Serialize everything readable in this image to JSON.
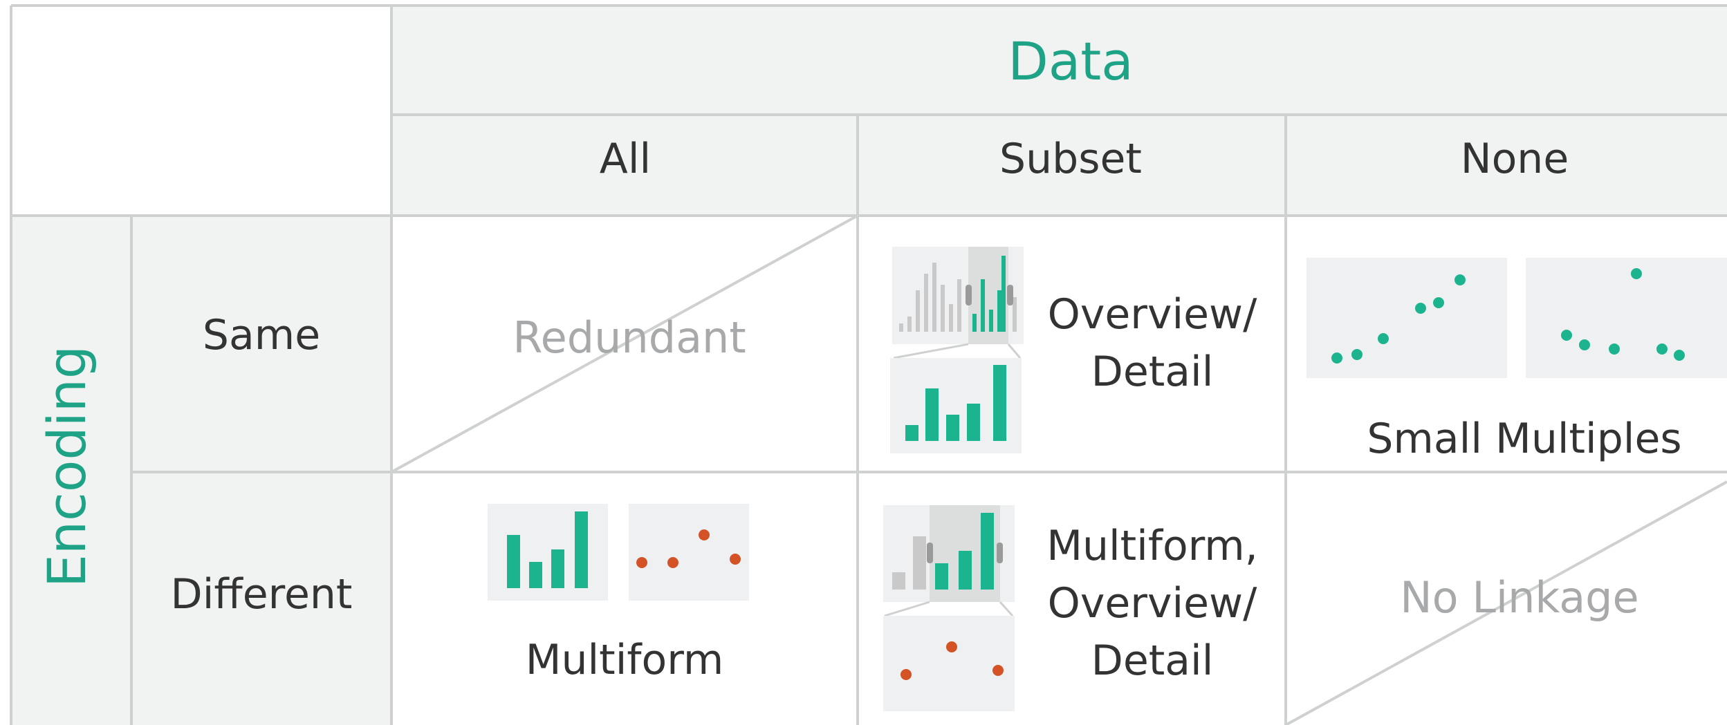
{
  "title": "Data",
  "row_axis_label": "Encoding",
  "columns": [
    "All",
    "Subset",
    "None"
  ],
  "rows": [
    "Same",
    "Different"
  ],
  "cells": {
    "same_all": "Redundant",
    "same_subset": [
      "Overview/",
      "Detail"
    ],
    "same_none": "Small Multiples",
    "different_all": "Multiform",
    "different_subset": [
      "Multiform,",
      "Overview/",
      "Detail"
    ],
    "different_none": "No Linkage"
  },
  "colors": {
    "accent": "#1fa387",
    "teal_mark": "#1cb38f",
    "orange_mark": "#d45326",
    "header_bg": "#f1f2f2",
    "grid_line": "#cfd0d0",
    "muted_text": "#a7a9ab",
    "body_text": "#333333",
    "thumb_bg": "#eff0f1",
    "grey_mark": "#c9c9c9"
  }
}
